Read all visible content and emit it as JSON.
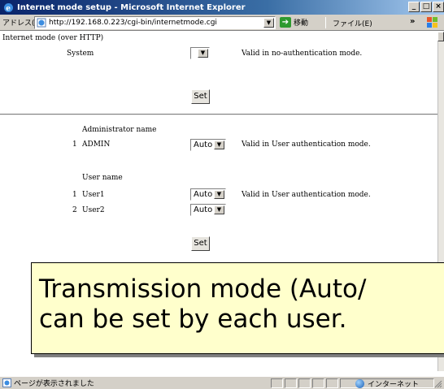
{
  "window": {
    "title": "Internet mode setup - Microsoft Internet Explorer",
    "min": "_",
    "max": "□",
    "close": "×"
  },
  "addressbar": {
    "label": "アドレス(D)",
    "url": "http://192.168.0.223/cgi-bin/internetmode.cgi",
    "go_label": "移動",
    "file_menu": "ファイル(E)",
    "chevron": "»"
  },
  "page": {
    "heading": "Internet mode (over HTTP)",
    "system": {
      "label": "System",
      "value": "",
      "note": "Valid in no-authentication mode.",
      "set_label": "Set"
    },
    "admin": {
      "header": "Administrator name",
      "rows": [
        {
          "num": "1",
          "name": "ADMIN",
          "value": "Auto"
        }
      ],
      "note": "Valid in User authentication mode."
    },
    "users": {
      "header": "User name",
      "rows": [
        {
          "num": "1",
          "name": "User1",
          "value": "Auto"
        },
        {
          "num": "2",
          "name": "User2",
          "value": "Auto"
        }
      ],
      "note": "Valid in User authentication mode.",
      "set_label": "Set"
    }
  },
  "callout": {
    "line1": "Transmission mode (Auto/",
    "line2": "can be set by each user."
  },
  "statusbar": {
    "text": "ページが表示されました",
    "zone": "インターネット"
  }
}
